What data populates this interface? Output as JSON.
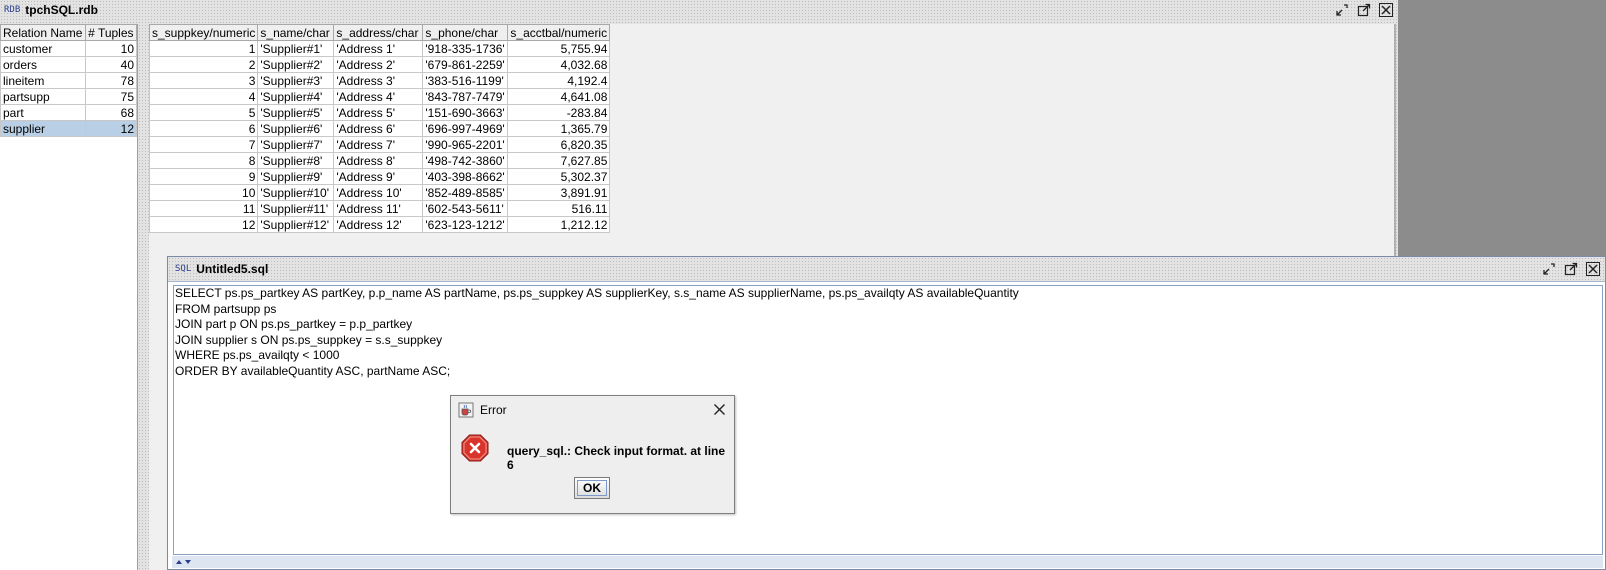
{
  "db_window": {
    "badge": "RDB",
    "title": "tpchSQL.rdb"
  },
  "relations": {
    "headers": [
      "Relation Name",
      "# Tuples"
    ],
    "rows": [
      {
        "name": "customer",
        "tuples": "10"
      },
      {
        "name": "orders",
        "tuples": "40"
      },
      {
        "name": "lineitem",
        "tuples": "78"
      },
      {
        "name": "partsupp",
        "tuples": "75"
      },
      {
        "name": "part",
        "tuples": "68"
      },
      {
        "name": "supplier",
        "tuples": "12"
      }
    ],
    "selected": "supplier"
  },
  "supplier_table": {
    "headers": [
      "s_suppkey/numeric",
      "s_name/char",
      "s_address/char",
      "s_phone/char",
      "s_acctbal/numeric"
    ],
    "rows": [
      [
        "1",
        "'Supplier#1'",
        "'Address 1'",
        "'918-335-1736'",
        "5,755.94"
      ],
      [
        "2",
        "'Supplier#2'",
        "'Address 2'",
        "'679-861-2259'",
        "4,032.68"
      ],
      [
        "3",
        "'Supplier#3'",
        "'Address 3'",
        "'383-516-1199'",
        "4,192.4"
      ],
      [
        "4",
        "'Supplier#4'",
        "'Address 4'",
        "'843-787-7479'",
        "4,641.08"
      ],
      [
        "5",
        "'Supplier#5'",
        "'Address 5'",
        "'151-690-3663'",
        "-283.84"
      ],
      [
        "6",
        "'Supplier#6'",
        "'Address 6'",
        "'696-997-4969'",
        "1,365.79"
      ],
      [
        "7",
        "'Supplier#7'",
        "'Address 7'",
        "'990-965-2201'",
        "6,820.35"
      ],
      [
        "8",
        "'Supplier#8'",
        "'Address 8'",
        "'498-742-3860'",
        "7,627.85"
      ],
      [
        "9",
        "'Supplier#9'",
        "'Address 9'",
        "'403-398-8662'",
        "5,302.37"
      ],
      [
        "10",
        "'Supplier#10'",
        "'Address 10'",
        "'852-489-8585'",
        "3,891.91"
      ],
      [
        "11",
        "'Supplier#11'",
        "'Address 11'",
        "'602-543-5611'",
        "516.11"
      ],
      [
        "12",
        "'Supplier#12'",
        "'Address 12'",
        "'623-123-1212'",
        "1,212.12"
      ]
    ]
  },
  "sql_window": {
    "badge": "SQL",
    "title": "Untitled5.sql",
    "lines": [
      "SELECT ps.ps_partkey AS partKey, p.p_name AS partName, ps.ps_suppkey AS supplierKey, s.s_name AS supplierName, ps.ps_availqty AS availableQuantity",
      "FROM partsupp ps",
      "JOIN part p ON ps.ps_partkey = p.p_partkey",
      "JOIN supplier s ON ps.ps_suppkey = s.s_suppkey",
      "WHERE ps.ps_availqty < 1000",
      "ORDER BY availableQuantity ASC, partName ASC;"
    ]
  },
  "error_dialog": {
    "title": "Error",
    "message": "query_sql.: Check input format. at line 6",
    "ok_label": "OK"
  },
  "colors": {
    "selection": "#b8cfe5",
    "error_icon": "#d9342b",
    "frame_border": "#7a8aa8"
  },
  "icons": [
    "restore-icon",
    "maximize-icon",
    "close-icon",
    "error-icon",
    "java-cup-icon"
  ]
}
